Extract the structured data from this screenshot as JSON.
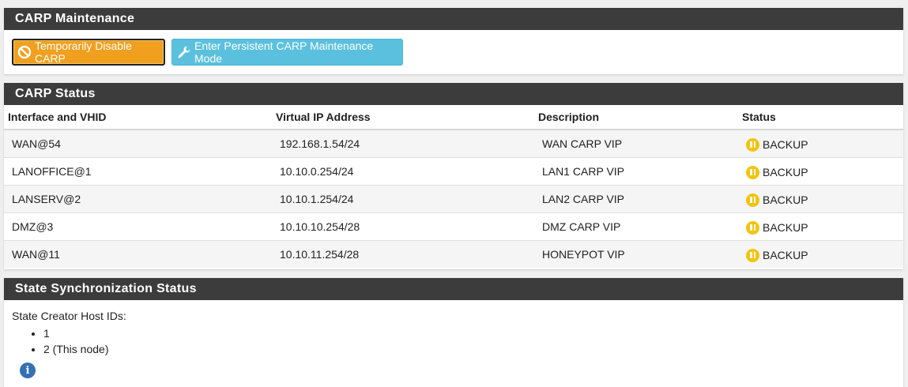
{
  "maintenance": {
    "title": "CARP Maintenance",
    "disable_button": "Temporarily Disable CARP",
    "persistent_button": "Enter Persistent CARP Maintenance Mode"
  },
  "status": {
    "title": "CARP Status",
    "headers": [
      "Interface and VHID",
      "Virtual IP Address",
      "Description",
      "Status"
    ],
    "rows": [
      {
        "iface": "WAN@54",
        "vip": "192.168.1.54/24",
        "desc": "WAN CARP VIP",
        "state": "BACKUP"
      },
      {
        "iface": "LANOFFICE@1",
        "vip": "10.10.0.254/24",
        "desc": "LAN1 CARP VIP",
        "state": "BACKUP"
      },
      {
        "iface": "LANSERV@2",
        "vip": "10.10.1.254/24",
        "desc": "LAN2 CARP VIP",
        "state": "BACKUP"
      },
      {
        "iface": "DMZ@3",
        "vip": "10.10.10.254/28",
        "desc": "DMZ CARP VIP",
        "state": "BACKUP"
      },
      {
        "iface": "WAN@11",
        "vip": "10.10.11.254/28",
        "desc": "HONEYPOT VIP",
        "state": "BACKUP"
      }
    ]
  },
  "sync": {
    "title": "State Synchronization Status",
    "label": "State Creator Host IDs:",
    "hosts": [
      "1",
      "2 (This node)"
    ]
  },
  "colors": {
    "heading_bg": "#3c3c3c",
    "warning": "#f0a01e",
    "info": "#5bc0de",
    "backup_status": "#f1c40f",
    "info_icon": "#3470b3"
  },
  "icons": {
    "disable": "ban-icon",
    "persistent": "wrench-icon",
    "status": "pause-circle-icon",
    "help": "info-circle-icon"
  }
}
